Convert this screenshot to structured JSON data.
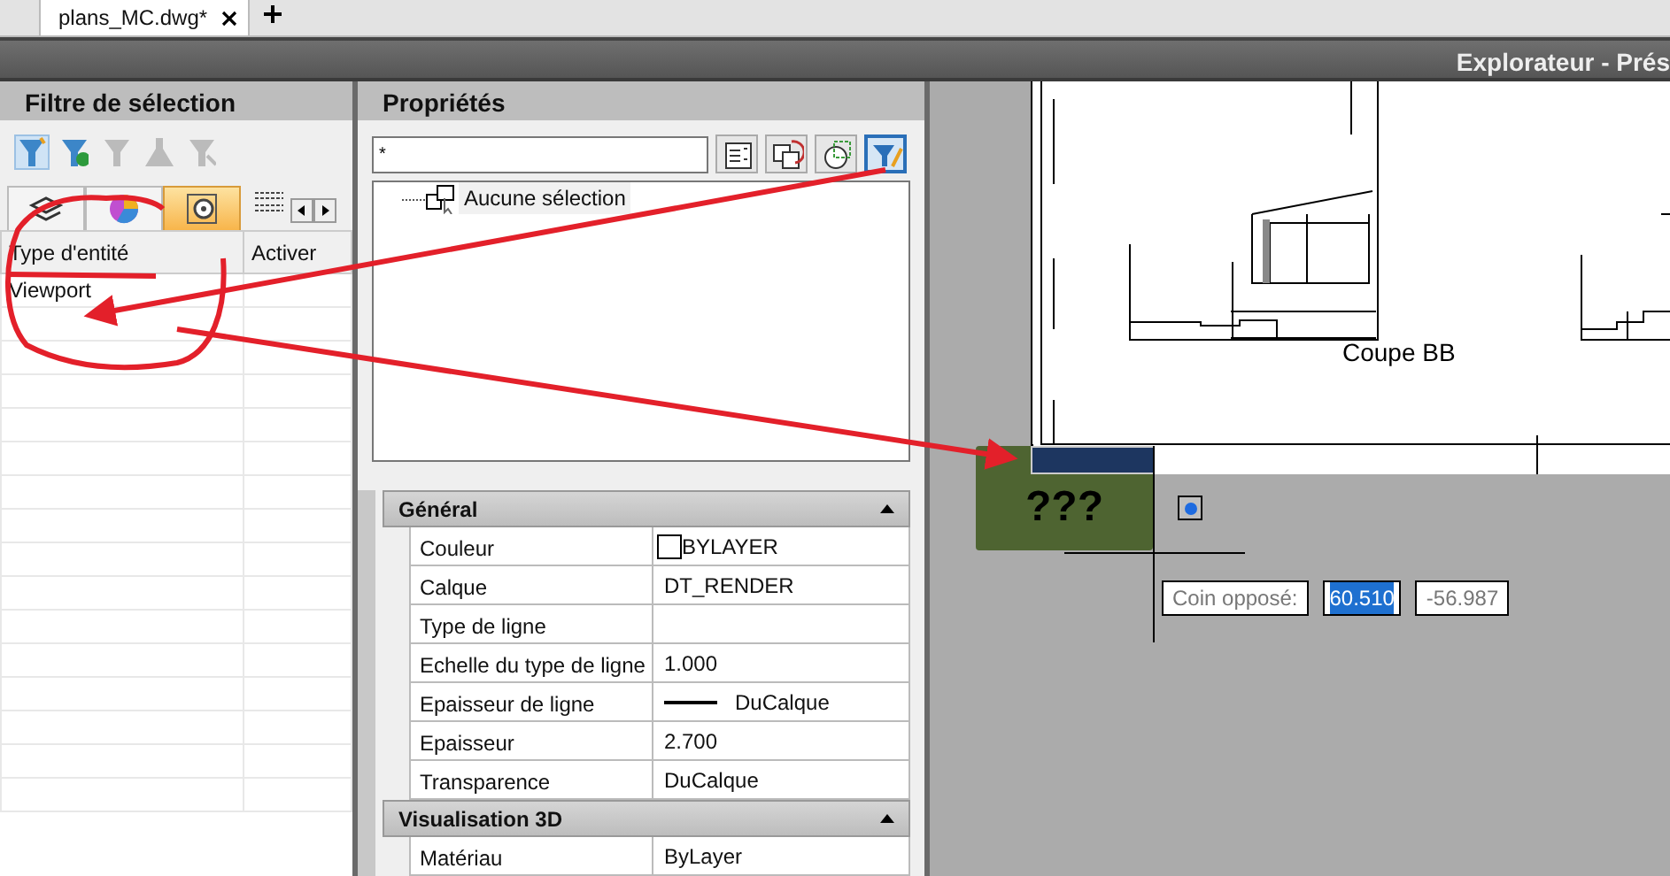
{
  "document_tabs": [
    {
      "label": "plans_MC.dwg*",
      "selected": true
    }
  ],
  "toolbar": {
    "title": "Explorateur - Prés"
  },
  "selection_filter": {
    "title": "Filtre de sélection",
    "tools": [
      {
        "selected": true,
        "disabled": false
      },
      {
        "selected": false,
        "disabled": false
      },
      {
        "selected": false,
        "disabled": true
      },
      {
        "selected": false,
        "disabled": true
      },
      {
        "selected": false,
        "disabled": true
      }
    ],
    "tabs": [
      {
        "selected": false
      },
      {
        "selected": false
      },
      {
        "selected": true
      }
    ],
    "columns": [
      "Type d'entité",
      "Activer"
    ],
    "rows": [
      {
        "entity_type": "Viewport"
      }
    ]
  },
  "properties": {
    "title": "Propriétés",
    "search": {
      "value": "*"
    },
    "buttons": [
      {
        "selected": false
      },
      {
        "selected": false
      },
      {
        "selected": false
      },
      {
        "selected": true
      }
    ],
    "tree": {
      "label": "Aucune sélection"
    },
    "categories": [
      {
        "title": "Général",
        "expanded": true,
        "rows": [
          {
            "name": "Couleur",
            "kind": "swatch",
            "value": "BYLAYER"
          },
          {
            "name": "Calque",
            "kind": "text",
            "value": "DT_RENDER"
          },
          {
            "name": "Type de ligne",
            "kind": "text"
          },
          {
            "name": "Echelle du type de ligne",
            "kind": "text",
            "value": "1.000"
          },
          {
            "name": "Epaisseur de ligne",
            "kind": "lineweight",
            "value": "DuCalque"
          },
          {
            "name": "Epaisseur",
            "kind": "text",
            "value": "2.700"
          },
          {
            "name": "Transparence",
            "kind": "text",
            "value": "DuCalque"
          }
        ]
      },
      {
        "title": "Visualisation 3D",
        "expanded": true,
        "rows": [
          {
            "name": "Matériau",
            "kind": "text",
            "value": "ByLayer"
          }
        ]
      }
    ]
  },
  "canvas": {
    "sheet_label": "Coupe BB",
    "marker_label": "???",
    "prompt": {
      "label": "Coin opposé:",
      "x_value": "60.510",
      "y_value": "-56.987",
      "x_selected": true
    }
  }
}
